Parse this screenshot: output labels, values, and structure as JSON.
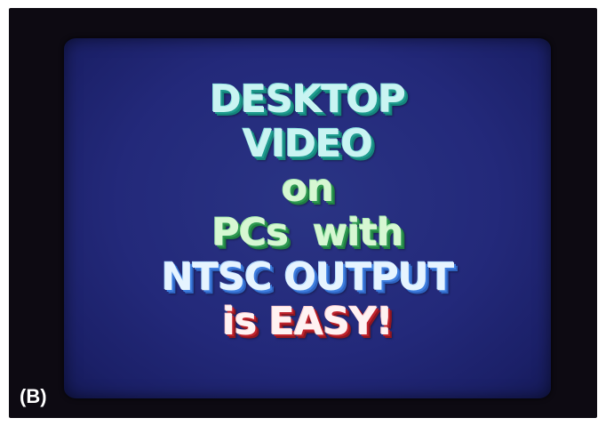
{
  "crt": {
    "lines": [
      {
        "text": "DESKTOP",
        "color": "#c9f4f2",
        "shadow_color": "#1f9c8f"
      },
      {
        "text": "VIDEO",
        "color": "#c9f4f2",
        "shadow_color": "#1f9c8f"
      },
      {
        "text": "on",
        "color": "#d6f7d2",
        "shadow_color": "#2f9a52"
      },
      {
        "text": "PCs  with",
        "color": "#d6f7d2",
        "shadow_color": "#2f9a52"
      },
      {
        "text": "NTSC OUTPUT",
        "color": "#e6f4ff",
        "shadow_color": "#3f7fe0"
      },
      {
        "text": "is EASY!",
        "color": "#fff2f2",
        "shadow_color": "#c0232c"
      }
    ]
  },
  "figure": {
    "label": "(B)"
  },
  "colors": {
    "screen_background": "#23297a",
    "bezel": "#0d0a12"
  }
}
